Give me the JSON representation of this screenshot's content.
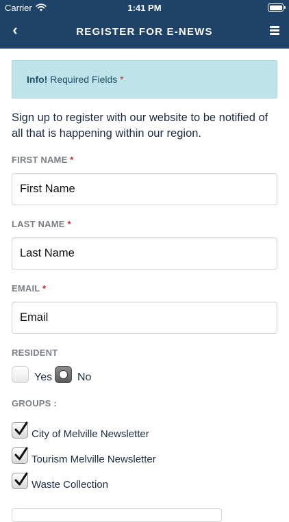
{
  "status_bar": {
    "carrier": "Carrier",
    "time": "1:41 PM"
  },
  "nav": {
    "title": "REGISTER FOR E-NEWS",
    "back_icon": "chevron-left-icon",
    "menu_icon": "hamburger-menu-icon"
  },
  "info": {
    "strong": "Info!",
    "text": "Required Fields",
    "required_mark": "*"
  },
  "intro": "Sign up to register with our website to be notified of all that is happening within our region.",
  "form": {
    "first_name": {
      "label": "FIRST NAME",
      "required": "*",
      "placeholder": "First Name",
      "value": ""
    },
    "last_name": {
      "label": "LAST NAME",
      "required": "*",
      "placeholder": "Last Name",
      "value": ""
    },
    "email": {
      "label": "EMAIL",
      "required": "*",
      "placeholder": "Email",
      "value": ""
    },
    "resident": {
      "label": "RESIDENT",
      "options": [
        {
          "label": "Yes",
          "selected": false
        },
        {
          "label": "No",
          "selected": true
        }
      ]
    },
    "groups": {
      "label": "GROUPS :",
      "items": [
        {
          "label": "City of Melville Newsletter",
          "checked": true
        },
        {
          "label": "Tourism Melville Newsletter",
          "checked": true
        },
        {
          "label": "Waste Collection",
          "checked": true
        }
      ]
    }
  },
  "colors": {
    "header": "#1e4268",
    "info_bg": "#bfe3ea",
    "required": "#c62828",
    "label": "#7a7f86"
  }
}
